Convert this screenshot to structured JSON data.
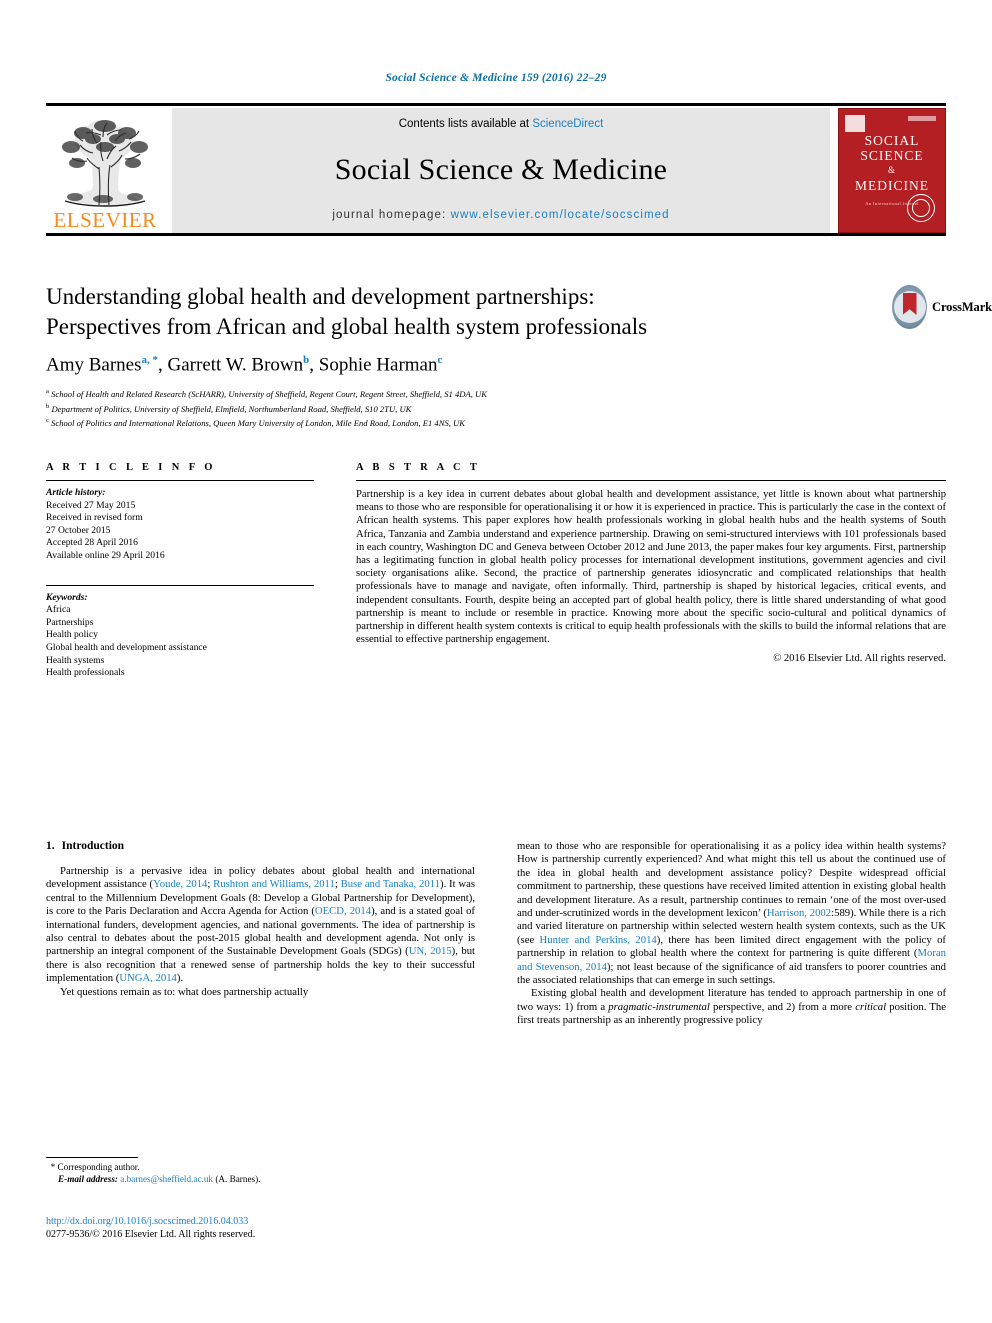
{
  "running_head": "Social Science & Medicine 159 (2016) 22–29",
  "masthead": {
    "contents_prefix": "Contents lists available at ",
    "sciencedirect": "ScienceDirect",
    "journal_title": "Social Science & Medicine",
    "homepage_label": "journal homepage: ",
    "homepage_url": "www.elsevier.com/locate/socscimed",
    "publisher": "ELSEVIER",
    "cover": {
      "line1": "SOCIAL",
      "line2": "SCIENCE",
      "amp": "&",
      "line3": "MEDICINE",
      "subtitle": "An International Journal"
    }
  },
  "crossmark": {
    "label": "CrossMark"
  },
  "article": {
    "title_line1": "Understanding global health and development partnerships:",
    "title_line2": "Perspectives from African and global health system professionals",
    "authors": [
      {
        "name": "Amy Barnes",
        "marks": "a, *"
      },
      {
        "name": "Garrett W. Brown",
        "marks": "b"
      },
      {
        "name": "Sophie Harman",
        "marks": "c"
      }
    ],
    "affiliations": [
      {
        "mark": "a",
        "text": "School of Health and Related Research (ScHARR), University of Sheffield, Regent Court, Regent Street, Sheffield, S1 4DA, UK"
      },
      {
        "mark": "b",
        "text": "Department of Politics, University of Sheffield, Elmfield, Northumberland Road, Sheffield, S10 2TU, UK"
      },
      {
        "mark": "c",
        "text": "School of Politics and International Relations, Queen Mary University of London, Mile End Road, London, E1 4NS, UK"
      }
    ]
  },
  "article_info": {
    "heading": "A R T I C L E  I N F O",
    "history_label": "Article history:",
    "history": [
      "Received 27 May 2015",
      "Received in revised form",
      "27 October 2015",
      "Accepted 28 April 2016",
      "Available online 29 April 2016"
    ],
    "keywords_label": "Keywords:",
    "keywords": [
      "Africa",
      "Partnerships",
      "Health policy",
      "Global health and development assistance",
      "Health systems",
      "Health professionals"
    ]
  },
  "abstract": {
    "heading": "A B S T R A C T",
    "text": "Partnership is a key idea in current debates about global health and development assistance, yet little is known about what partnership means to those who are responsible for operationalising it or how it is experienced in practice. This is particularly the case in the context of African health systems. This paper explores how health professionals working in global health hubs and the health systems of South Africa, Tanzania and Zambia understand and experience partnership. Drawing on semi-structured interviews with 101 professionals based in each country, Washington DC and Geneva between October 2012 and June 2013, the paper makes four key arguments. First, partnership has a legitimating function in global health policy processes for international development institutions, government agencies and civil society organisations alike. Second, the practice of partnership generates idiosyncratic and complicated relationships that health professionals have to manage and navigate, often informally. Third, partnership is shaped by historical legacies, critical events, and independent consultants. Fourth, despite being an accepted part of global health policy, there is little shared understanding of what good partnership is meant to include or resemble in practice. Knowing more about the specific socio-cultural and political dynamics of partnership in different health system contexts is critical to equip health professionals with the skills to build the informal relations that are essential to effective partnership engagement.",
    "copyright": "© 2016 Elsevier Ltd. All rights reserved."
  },
  "body": {
    "section_number": "1.",
    "section_title": "Introduction",
    "left": {
      "para1": {
        "s1": "Partnership is a pervasive idea in policy debates about global health and international development assistance (",
        "r1": "Youde, 2014",
        "s2": "; ",
        "r2": "Rushton and Williams, 2011",
        "s3": "; ",
        "r3": "Buse and Tanaka, 2011",
        "s4": "). It was central to the Millennium Development Goals (8: Develop a Global Partnership for Development), is core to the Paris Declaration and Accra Agenda for Action (",
        "r4": "OECD, 2014",
        "s5": "), and is a stated goal of international funders, development agencies, and national governments. The idea of partnership is also central to debates about the post-2015 global health and development agenda. Not only is partnership an integral component of the Sustainable Development Goals (SDGs) (",
        "r5": "UN, 2015",
        "s6": "), but there is also recognition that a renewed sense of partnership holds the key to their successful implementation (",
        "r6": "UNGA, 2014",
        "s7": ")."
      },
      "para2": "Yet questions remain as to: what does partnership actually"
    },
    "right": {
      "para1": {
        "s1": "mean to those who are responsible for operationalising it as a policy idea within health systems? How is partnership currently experienced? And what might this tell us about the continued use of the idea in global health and development assistance policy? Despite widespread official commitment to partnership, these questions have received limited attention in existing global health and development literature. As a result, partnership continues to remain ‘one of the most over-used and under-scrutinized words in the development lexicon’ (",
        "r1": "Harrison, 2002",
        "s2": ":589). While there is a rich and varied literature on partnership within selected western health system contexts, such as the UK (see ",
        "r2": "Hunter and Perkins, 2014",
        "s3": "), there has been limited direct engagement with the policy of partnership in relation to global health where the context for partnering is quite different (",
        "r3": "Moran and Stevenson, 2014",
        "s4": "); not least because of the significance of aid transfers to poorer countries and the associated relationships that can emerge in such settings."
      },
      "para2": {
        "s1": "Existing global health and development literature has tended to approach partnership in one of two ways: 1) from a ",
        "i1": "pragmatic-instrumental",
        "s2": " perspective, and 2) from a more ",
        "i2": "critical",
        "s3": " position. The first treats partnership as an inherently progressive policy"
      }
    }
  },
  "footnote": {
    "corresponding_mark": "*",
    "corresponding_text": "Corresponding author.",
    "email_label": "E-mail address:",
    "email": "a.barnes@sheffield.ac.uk",
    "email_owner": "(A. Barnes)."
  },
  "footer": {
    "doi": "http://dx.doi.org/10.1016/j.socscimed.2016.04.033",
    "issn_line": "0277-9536/© 2016 Elsevier Ltd. All rights reserved."
  },
  "colors": {
    "link": "#1a7fc1",
    "elsevier_orange": "#f68a1e",
    "cover_red": "#b41f23"
  }
}
